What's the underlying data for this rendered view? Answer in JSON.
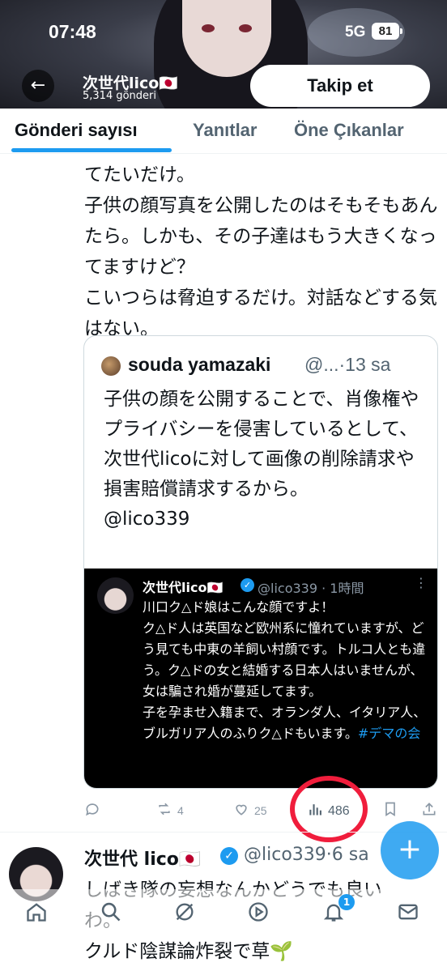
{
  "status_bar": {
    "time": "07:48",
    "network": "5G",
    "battery": "81"
  },
  "header": {
    "back_icon": "back-arrow-icon",
    "name": "次世代lico🇯🇵",
    "posts_count": "5,314 gönderi",
    "follow_label": "Takip et"
  },
  "tabs": [
    {
      "label": "Gönderi sayısı",
      "active": true
    },
    {
      "label": "Yanıtlar",
      "active": false
    },
    {
      "label": "Öne Çıkanlar",
      "active": false
    }
  ],
  "tweet": {
    "text": "てたいだけ。\n子供の顔写真を公開したのはそもそもあんたら。しかも、その子達はもう大きくなってますけど？\nこいつらは脅迫するだけ。対話などする気はない。"
  },
  "quote": {
    "author": "souda yamazaki",
    "handle_time": "@...·13 sa",
    "text": "子供の顔を公開することで、肖像権やプライバシーを侵害しているとして、次世代licoに対して画像の削除請求や損害賠償請求するから。\n@lico339",
    "embedded": {
      "name": "次世代lico🇯🇵",
      "handle_time": "@lico339 · 1時間",
      "text": "川口ク△ド娘はこんな顔ですよ！\nク△ド人は英国など欧州系に憧れていますが、どう見ても中東の羊飼い村顔です。トルコ人とも違う。ク△ドの女と結婚する日本人はいませんが、女は騙され婚が蔓延してます。\n子を孕ませ入籍まで、オランダ人、イタリア人、ブルガリア人のふりク△ドもいます。",
      "hashtag": "#デマの会"
    }
  },
  "actions": {
    "reply_count": "",
    "retweet_count": "4",
    "like_count": "25",
    "views_count": "486",
    "highlight_color": "#f01d3c"
  },
  "tweet2": {
    "name": "次世代 lico🇯🇵",
    "handle_time": "@lico339·6 sa",
    "text": "しばき隊の妄想なんかどうでも良いわ。\nクルド陰謀論炸裂で草🌱"
  },
  "fab_label": "+",
  "bottom_nav": {
    "items": [
      "home-icon",
      "search-icon",
      "grok-icon",
      "video-icon",
      "notifications-icon",
      "messages-icon"
    ],
    "notifications_badge": "1"
  },
  "colors": {
    "accent": "#1d9bf0",
    "text": "#0f1419",
    "secondary": "#536471"
  }
}
